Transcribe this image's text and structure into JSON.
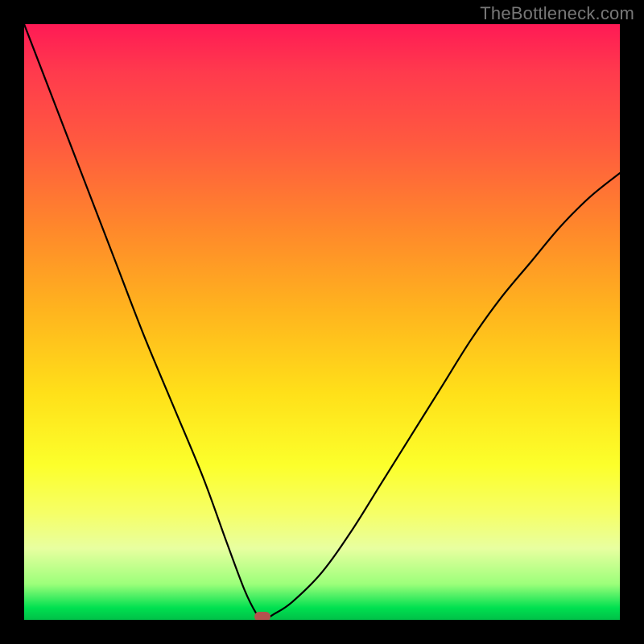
{
  "watermark": "TheBottleneck.com",
  "chart_data": {
    "type": "line",
    "title": "",
    "xlabel": "",
    "ylabel": "",
    "xlim": [
      0,
      100
    ],
    "ylim": [
      0,
      100
    ],
    "grid": false,
    "legend": false,
    "background": {
      "type": "vertical-gradient",
      "stops": [
        {
          "pos": 0.0,
          "color": "#ff1a55"
        },
        {
          "pos": 0.08,
          "color": "#ff3a4d"
        },
        {
          "pos": 0.2,
          "color": "#ff5a3f"
        },
        {
          "pos": 0.35,
          "color": "#ff8a2a"
        },
        {
          "pos": 0.48,
          "color": "#ffb41e"
        },
        {
          "pos": 0.62,
          "color": "#ffe019"
        },
        {
          "pos": 0.74,
          "color": "#fcff2b"
        },
        {
          "pos": 0.82,
          "color": "#f6ff66"
        },
        {
          "pos": 0.88,
          "color": "#e8ffa0"
        },
        {
          "pos": 0.94,
          "color": "#9cff7a"
        },
        {
          "pos": 0.98,
          "color": "#00e050"
        },
        {
          "pos": 1.0,
          "color": "#00c048"
        }
      ]
    },
    "series": [
      {
        "name": "bottleneck-curve",
        "color": "#000000",
        "x": [
          0,
          5,
          10,
          15,
          20,
          25,
          30,
          34,
          37,
          39,
          40,
          42,
          45,
          50,
          55,
          60,
          65,
          70,
          75,
          80,
          85,
          90,
          95,
          100
        ],
        "y": [
          100,
          87,
          74,
          61,
          48,
          36,
          24,
          13,
          5,
          1,
          0,
          1,
          3,
          8,
          15,
          23,
          31,
          39,
          47,
          54,
          60,
          66,
          71,
          75
        ]
      }
    ],
    "marker": {
      "name": "optimal-point",
      "x": 40,
      "y": 0,
      "color": "#b4524e"
    }
  }
}
